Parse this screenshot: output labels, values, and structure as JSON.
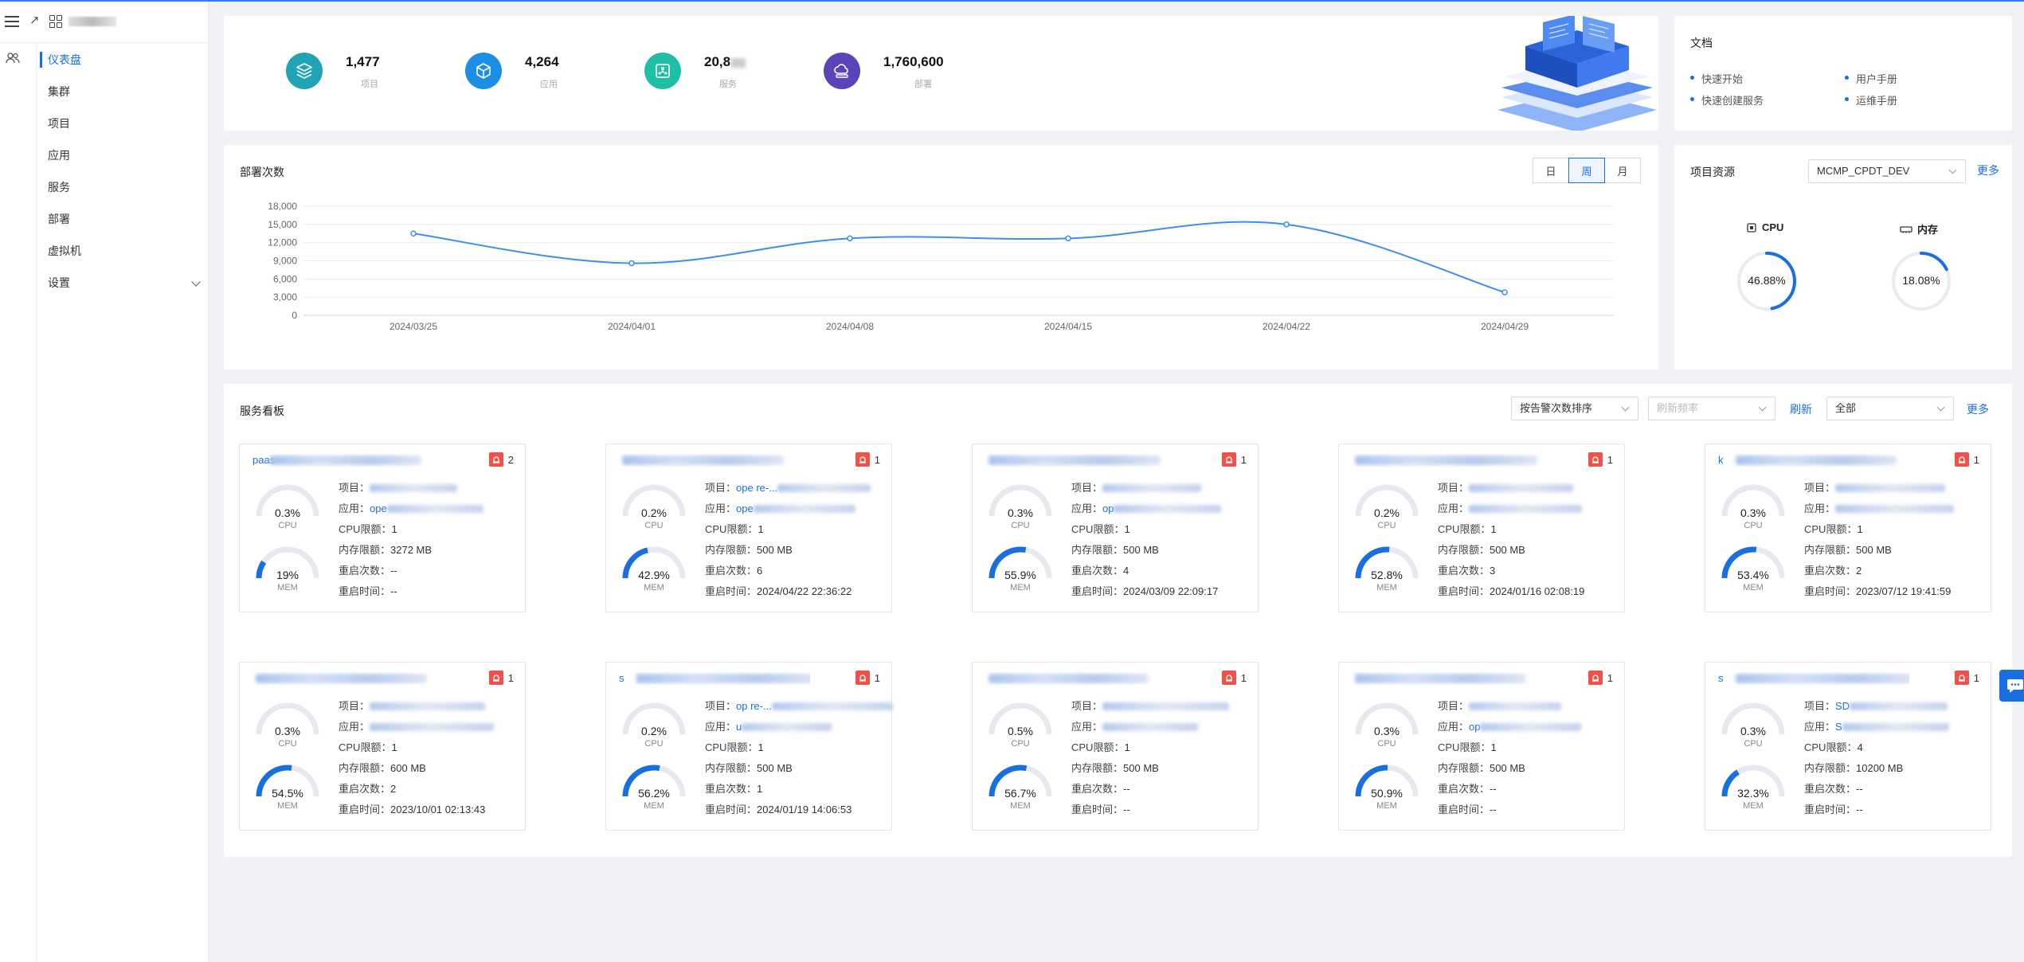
{
  "colors": {
    "accent": "#1a6fe0",
    "alert": "#f0524b",
    "line": "#3d8fe8"
  },
  "sidebar": {
    "items": [
      {
        "label": "仪表盘",
        "active": true
      },
      {
        "label": "集群"
      },
      {
        "label": "项目"
      },
      {
        "label": "应用"
      },
      {
        "label": "服务"
      },
      {
        "label": "部署"
      },
      {
        "label": "虚拟机"
      },
      {
        "label": "设置",
        "expandable": true
      }
    ]
  },
  "stats": [
    {
      "value": "1,477",
      "label": "项目",
      "icon": "layers-icon",
      "color": "#1fa3b5"
    },
    {
      "value": "4,264",
      "label": "应用",
      "icon": "cube-icon",
      "color": "#1b8fe6"
    },
    {
      "value": "20,8",
      "label": "服务",
      "icon": "network-icon",
      "color": "#1fbfa5"
    },
    {
      "value": "1,760,600",
      "label": "部署",
      "icon": "cloud-icon",
      "color": "#5b43b8"
    }
  ],
  "docs": {
    "title": "文档",
    "links": [
      "快速开始",
      "用户手册",
      "快速创建服务",
      "运维手册"
    ]
  },
  "deploy": {
    "title": "部署次数",
    "ranges": [
      "日",
      "周",
      "月"
    ],
    "active_range": "周"
  },
  "chart_data": {
    "type": "line",
    "x": [
      "2024/03/25",
      "2024/04/01",
      "2024/04/08",
      "2024/04/15",
      "2024/04/22",
      "2024/04/29"
    ],
    "series": [
      {
        "values": [
          13500,
          8600,
          12700,
          12700,
          15000,
          3800
        ]
      }
    ],
    "yticks": [
      0,
      3000,
      6000,
      9000,
      12000,
      15000,
      18000
    ],
    "ytick_labels": [
      "0",
      "3,000",
      "6,000",
      "9,000",
      "12,000",
      "15,000",
      "18,000"
    ],
    "ylim": [
      0,
      18000
    ],
    "grid": true
  },
  "resources": {
    "title": "项目资源",
    "project": "MCMP_CPDT_DEV",
    "more": "更多",
    "cpu": {
      "label": "CPU",
      "value": "46.88%",
      "fraction": 0.4688
    },
    "mem": {
      "label": "内存",
      "value": "18.08%",
      "fraction": 0.1808
    }
  },
  "board": {
    "title": "服务看板",
    "sort": "按告警次数排序",
    "refresh_placeholder": "刷新频率",
    "refresh": "刷新",
    "filter": "全部",
    "more": "更多",
    "labels": {
      "project": "项目：",
      "app": "应用：",
      "cpu_limit": "CPU限额：",
      "mem_limit": "内存限额：",
      "restarts": "重启次数：",
      "restart_time": "重启时间：",
      "cpu": "CPU",
      "mem": "MEM"
    },
    "services": [
      {
        "name_prefix": "paas-",
        "alerts": "2",
        "cpu": "0.3%",
        "cpu_f": 0.003,
        "mem": "19%",
        "mem_f": 0.19,
        "project": "",
        "app": "ope",
        "cpu_limit": "1",
        "mem_limit": "3272 MB",
        "restarts": "--",
        "restart_time": "--"
      },
      {
        "name_prefix": "",
        "alerts": "1",
        "cpu": "0.2%",
        "cpu_f": 0.002,
        "mem": "42.9%",
        "mem_f": 0.429,
        "project": "ope re-...",
        "app": "ope",
        "cpu_limit": "1",
        "mem_limit": "500 MB",
        "restarts": "6",
        "restart_time": "2024/04/22 22:36:22"
      },
      {
        "name_prefix": "",
        "alerts": "1",
        "cpu": "0.3%",
        "cpu_f": 0.003,
        "mem": "55.9%",
        "mem_f": 0.559,
        "project": "",
        "app": "op",
        "cpu_limit": "1",
        "mem_limit": "500 MB",
        "restarts": "4",
        "restart_time": "2024/03/09 22:09:17"
      },
      {
        "name_prefix": "",
        "alerts": "1",
        "cpu": "0.2%",
        "cpu_f": 0.002,
        "mem": "52.8%",
        "mem_f": 0.528,
        "project": "",
        "app": "",
        "cpu_limit": "1",
        "mem_limit": "500 MB",
        "restarts": "3",
        "restart_time": "2024/01/16 02:08:19"
      },
      {
        "name_prefix": "k",
        "alerts": "1",
        "cpu": "0.3%",
        "cpu_f": 0.003,
        "mem": "53.4%",
        "mem_f": 0.534,
        "project": "",
        "app": "",
        "cpu_limit": "1",
        "mem_limit": "500 MB",
        "restarts": "2",
        "restart_time": "2023/07/12 19:41:59"
      },
      {
        "name_prefix": "",
        "alerts": "1",
        "cpu": "0.3%",
        "cpu_f": 0.003,
        "mem": "54.5%",
        "mem_f": 0.545,
        "project": "",
        "app": "",
        "cpu_limit": "1",
        "mem_limit": "600 MB",
        "restarts": "2",
        "restart_time": "2023/10/01 02:13:43"
      },
      {
        "name_prefix": "s",
        "alerts": "1",
        "cpu": "0.2%",
        "cpu_f": 0.002,
        "mem": "56.2%",
        "mem_f": 0.562,
        "project": "op re-...",
        "app": "u",
        "cpu_limit": "1",
        "mem_limit": "500 MB",
        "restarts": "1",
        "restart_time": "2024/01/19 14:06:53"
      },
      {
        "name_prefix": "",
        "alerts": "1",
        "cpu": "0.5%",
        "cpu_f": 0.005,
        "mem": "56.7%",
        "mem_f": 0.567,
        "project": "",
        "app": "",
        "cpu_limit": "1",
        "mem_limit": "500 MB",
        "restarts": "--",
        "restart_time": "--"
      },
      {
        "name_prefix": "",
        "alerts": "1",
        "cpu": "0.3%",
        "cpu_f": 0.003,
        "mem": "50.9%",
        "mem_f": 0.509,
        "project": "",
        "app": "op",
        "cpu_limit": "1",
        "mem_limit": "500 MB",
        "restarts": "--",
        "restart_time": "--"
      },
      {
        "name_prefix": "s",
        "alerts": "1",
        "cpu": "0.3%",
        "cpu_f": 0.003,
        "mem": "32.3%",
        "mem_f": 0.323,
        "project": "SD",
        "app": "S",
        "cpu_limit": "4",
        "mem_limit": "10200 MB",
        "restarts": "--",
        "restart_time": "--"
      }
    ]
  }
}
